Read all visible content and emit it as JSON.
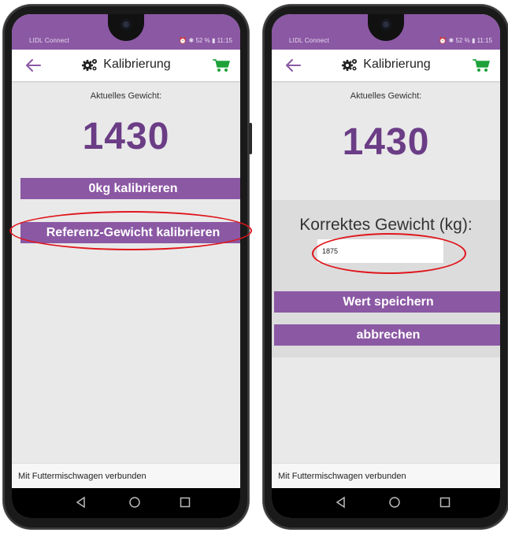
{
  "colors": {
    "primary": "#8b58a4",
    "weight_text": "#6b3d86",
    "highlight_ellipse": "#e0161c",
    "cart_icon": "#1fa13a"
  },
  "status_bar": {
    "carrier": "LIDL Connect",
    "right": "⏰ ✱ 52 % ▮ 11:15"
  },
  "app_bar": {
    "title": "Kalibrierung",
    "back_icon": "arrow-left-icon",
    "title_icon": "gears-icon",
    "action_icon": "cart-icon"
  },
  "current_weight_label": "Aktuelles Gewicht:",
  "current_weight_value": "1430",
  "left_screen": {
    "zero_button": "0kg kalibrieren",
    "reference_button": "Referenz-Gewicht kalibrieren"
  },
  "right_screen": {
    "dialog_title": "Korrektes Gewicht (kg):",
    "weight_input_value": "1875",
    "save_button": "Wert speichern",
    "cancel_button": "abbrechen"
  },
  "footer_status": "Mit Futtermischwagen verbunden",
  "nav_bar": {
    "back_icon": "nav-back-icon",
    "home_icon": "nav-home-icon",
    "recents_icon": "nav-recents-icon"
  }
}
